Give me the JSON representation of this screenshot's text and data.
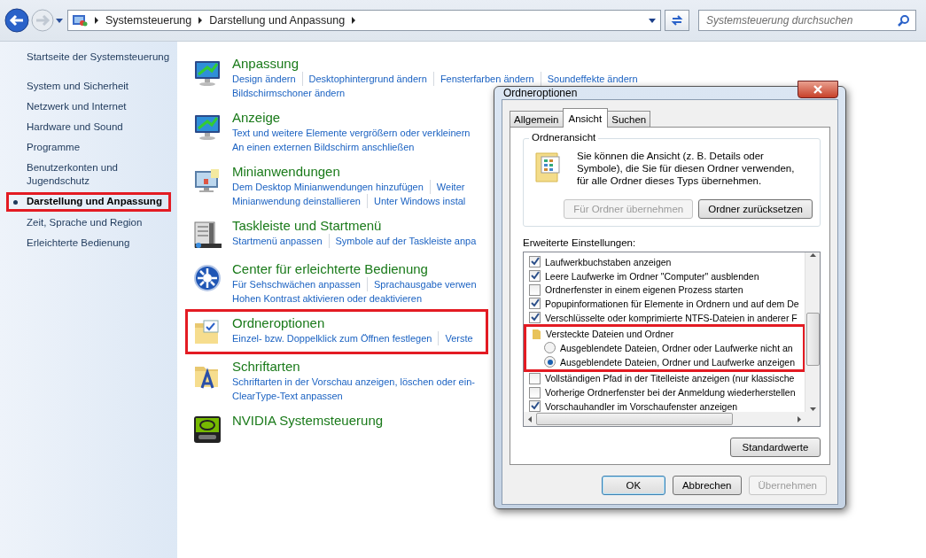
{
  "address_bar": {
    "breadcrumb": [
      "Systemsteuerung",
      "Darstellung und Anpassung"
    ],
    "search": {
      "placeholder": "Systemsteuerung durchsuchen"
    }
  },
  "sidebar": {
    "home": "Startseite der Systemsteuerung",
    "items": [
      {
        "label": "System und Sicherheit",
        "selected": false,
        "highlighted": false
      },
      {
        "label": "Netzwerk und Internet",
        "selected": false,
        "highlighted": false
      },
      {
        "label": "Hardware und Sound",
        "selected": false,
        "highlighted": false
      },
      {
        "label": "Programme",
        "selected": false,
        "highlighted": false
      },
      {
        "label": "Benutzerkonten und Jugendschutz",
        "selected": false,
        "highlighted": false
      },
      {
        "label": "Darstellung und Anpassung",
        "selected": true,
        "highlighted": true
      },
      {
        "label": "Zeit, Sprache und Region",
        "selected": false,
        "highlighted": false
      },
      {
        "label": "Erleichterte Bedienung",
        "selected": false,
        "highlighted": false
      }
    ]
  },
  "categories": [
    {
      "kind": "monitor",
      "title": "Anpassung",
      "highlighted": false,
      "links": [
        [
          "Design ändern",
          "Desktophintergrund ändern",
          "Fensterfarben ändern",
          "Soundeffekte ändern"
        ],
        [
          "Bildschirmschoner ändern"
        ]
      ]
    },
    {
      "kind": "monitor",
      "title": "Anzeige",
      "highlighted": false,
      "links": [
        [
          "Text und weitere Elemente vergrößern oder verkleinern"
        ],
        [
          "An einen externen Bildschirm anschließen"
        ]
      ]
    },
    {
      "kind": "gadget",
      "title": "Minianwendungen",
      "highlighted": false,
      "links": [
        [
          "Dem Desktop Minianwendungen hinzufügen",
          "Weiter"
        ],
        [
          "Minianwendung deinstallieren",
          "Unter Windows instal"
        ]
      ]
    },
    {
      "kind": "taskbar",
      "title": "Taskleiste und Startmenü",
      "highlighted": false,
      "links": [
        [
          "Startmenü anpassen",
          "Symbole auf der Taskleiste anpa"
        ]
      ]
    },
    {
      "kind": "access",
      "title": "Center für erleichterte Bedienung",
      "highlighted": false,
      "links": [
        [
          "Für Sehschwächen anpassen",
          "Sprachausgabe verwen"
        ],
        [
          "Hohen Kontrast aktivieren oder deaktivieren"
        ]
      ]
    },
    {
      "kind": "folder",
      "title": "Ordneroptionen",
      "highlighted": true,
      "links": [
        [
          "Einzel- bzw. Doppelklick zum Öffnen festlegen",
          "Verste"
        ]
      ]
    },
    {
      "kind": "font",
      "title": "Schriftarten",
      "highlighted": false,
      "links": [
        [
          "Schriftarten in der Vorschau anzeigen, löschen oder ein-"
        ],
        [
          "ClearType-Text anpassen"
        ]
      ]
    },
    {
      "kind": "nvidia",
      "title": "NVIDIA Systemsteuerung",
      "highlighted": false
    }
  ],
  "dialog": {
    "title": "Ordneroptionen",
    "tabs": [
      {
        "label": "Allgemein",
        "selected": false
      },
      {
        "label": "Ansicht",
        "selected": true
      },
      {
        "label": "Suchen",
        "selected": false
      }
    ],
    "group": {
      "title": "Ordneransicht",
      "text": "Sie können die Ansicht (z. B. Details oder Symbole), die Sie für diesen Ordner verwenden, für alle Ordner dieses Typs übernehmen.",
      "buttons": [
        {
          "label": "Für Ordner übernehmen",
          "disabled": true
        },
        {
          "label": "Ordner zurücksetzen",
          "disabled": false
        }
      ]
    },
    "settings_label": "Erweiterte Einstellungen:",
    "settings": [
      {
        "kind": "checkbox",
        "label": "Laufwerkbuchstaben anzeigen",
        "checked": true,
        "highlighted": false
      },
      {
        "kind": "checkbox",
        "label": "Leere Laufwerke im Ordner \"Computer\" ausblenden",
        "checked": true,
        "highlighted": false
      },
      {
        "kind": "checkbox",
        "label": "Ordnerfenster in einem eigenen Prozess starten",
        "checked": false,
        "highlighted": false
      },
      {
        "kind": "checkbox",
        "label": "Popupinformationen für Elemente in Ordnern und auf dem De",
        "checked": true,
        "highlighted": false
      },
      {
        "kind": "checkbox",
        "label": "Verschlüsselte oder komprimierte NTFS-Dateien in anderer F",
        "checked": true,
        "highlighted": false
      },
      {
        "kind": "folder",
        "label": "Versteckte Dateien und Ordner",
        "highlighted": true
      },
      {
        "kind": "radio",
        "label": "Ausgeblendete Dateien, Ordner oder Laufwerke nicht an",
        "selected": false,
        "highlighted": true
      },
      {
        "kind": "radio",
        "label": "Ausgeblendete Dateien, Ordner und Laufwerke anzeigen",
        "selected": true,
        "highlighted": true
      },
      {
        "kind": "checkbox",
        "label": "Vollständigen Pfad in der Titelleiste anzeigen (nur klassische",
        "checked": false,
        "highlighted": false
      },
      {
        "kind": "checkbox",
        "label": "Vorherige Ordnerfenster bei der Anmeldung wiederherstellen",
        "checked": false,
        "highlighted": false
      },
      {
        "kind": "checkbox",
        "label": "Vorschauhandler im Vorschaufenster anzeigen",
        "checked": true,
        "highlighted": false
      }
    ],
    "defaults_button": "Standardwerte",
    "buttons": [
      {
        "label": "OK",
        "disabled": false
      },
      {
        "label": "Abbrechen",
        "disabled": false
      },
      {
        "label": "Übernehmen",
        "disabled": true
      }
    ]
  }
}
